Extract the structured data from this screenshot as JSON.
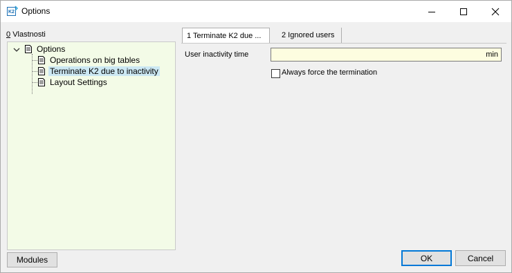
{
  "window": {
    "title": "Options",
    "app_icon": "k2-app-icon"
  },
  "left": {
    "section_prefix": "0",
    "section_label": "Vlastnosti",
    "tree": {
      "root": "Options",
      "items": [
        "Operations on big tables",
        "Terminate K2 due to inactivity",
        "Layout Settings"
      ],
      "selected_index": 1
    },
    "modules_button": "Modules"
  },
  "tabs": [
    "1 Terminate K2 due ...",
    "2 Ignored users"
  ],
  "active_tab": 0,
  "form": {
    "inactivity_label": "User inactivity time",
    "inactivity_value": "",
    "inactivity_unit": "min",
    "force_label": "Always force the termination",
    "force_checked": false
  },
  "buttons": {
    "ok": "OK",
    "cancel": "Cancel"
  },
  "colors": {
    "tree_bg": "#f3fbe7",
    "selected_bg": "#cce8f3",
    "field_bg": "#fdfde0",
    "default_border": "#0078d7"
  }
}
